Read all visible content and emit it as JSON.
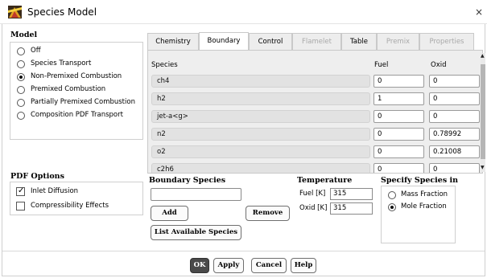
{
  "window": {
    "title": "Species Model",
    "close_glyph": "×"
  },
  "model": {
    "title": "Model",
    "options": [
      {
        "label": "Off",
        "selected": false
      },
      {
        "label": "Species Transport",
        "selected": false
      },
      {
        "label": "Non-Premixed Combustion",
        "selected": true
      },
      {
        "label": "Premixed Combustion",
        "selected": false
      },
      {
        "label": "Partially Premixed Combustion",
        "selected": false
      },
      {
        "label": "Composition PDF Transport",
        "selected": false
      }
    ]
  },
  "pdf_options": {
    "title": "PDF Options",
    "checks": [
      {
        "label": "Inlet Diffusion",
        "checked": true
      },
      {
        "label": "Compressibility Effects",
        "checked": false
      }
    ]
  },
  "tabs": [
    {
      "label": "Chemistry",
      "state": "normal"
    },
    {
      "label": "Boundary",
      "state": "active"
    },
    {
      "label": "Control",
      "state": "normal"
    },
    {
      "label": "Flamelet",
      "state": "disabled"
    },
    {
      "label": "Table",
      "state": "normal"
    },
    {
      "label": "Premix",
      "state": "disabled"
    },
    {
      "label": "Properties",
      "state": "disabled"
    }
  ],
  "boundary_table": {
    "columns": {
      "species": "Species",
      "fuel": "Fuel",
      "oxid": "Oxid"
    },
    "rows": [
      {
        "species": "ch4",
        "fuel": "0",
        "oxid": "0"
      },
      {
        "species": "h2",
        "fuel": "1",
        "oxid": "0"
      },
      {
        "species": "jet-a<g>",
        "fuel": "0",
        "oxid": "0"
      },
      {
        "species": "n2",
        "fuel": "0",
        "oxid": "0.78992"
      },
      {
        "species": "o2",
        "fuel": "0",
        "oxid": "0.21008"
      },
      {
        "species": "c2h6",
        "fuel": "0",
        "oxid": "0"
      }
    ]
  },
  "boundary_species": {
    "title": "Boundary Species",
    "input_value": "",
    "add_label": "Add",
    "remove_label": "Remove",
    "list_label": "List Available Species"
  },
  "temperature": {
    "title": "Temperature",
    "fuel_label": "Fuel [K]",
    "fuel_value": "315",
    "oxid_label": "Oxid [K]",
    "oxid_value": "315"
  },
  "specify_species": {
    "title": "Specify Species in",
    "options": [
      {
        "label": "Mass Fraction",
        "selected": false
      },
      {
        "label": "Mole Fraction",
        "selected": true
      }
    ]
  },
  "footer": {
    "ok": "OK",
    "apply": "Apply",
    "cancel": "Cancel",
    "help": "Help"
  },
  "colors": {
    "accent_dark": "#4a4a4a",
    "tab_active": "#ffffff",
    "panel_bg": "#eeeeee",
    "icon_red": "#c0392b",
    "icon_gold": "#e0a020"
  }
}
